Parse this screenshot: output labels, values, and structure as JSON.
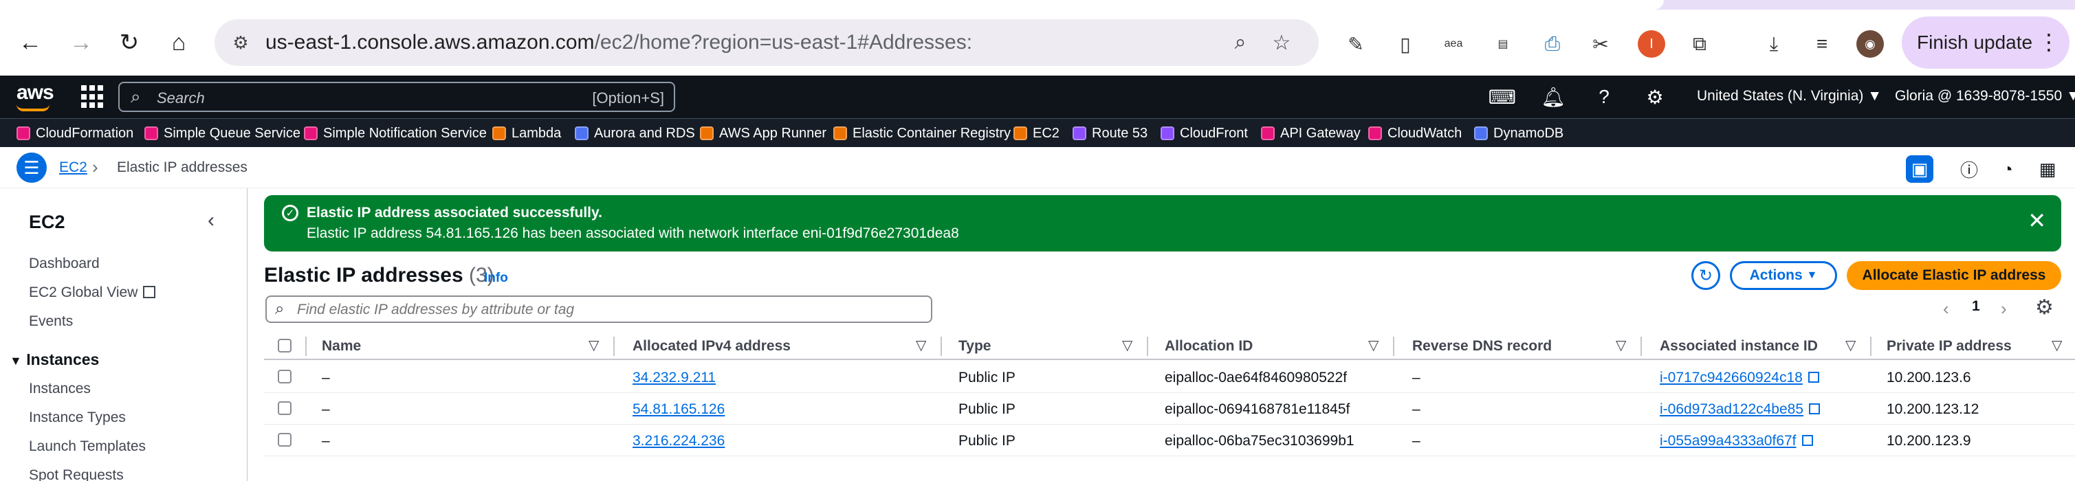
{
  "browser": {
    "url_host": "us-east-1.console.aws.amazon.com",
    "url_path": "/ec2/home?region=us-east-1#Addresses:",
    "finish_update_label": "Finish update"
  },
  "aws_nav": {
    "logo": "aws",
    "search_placeholder": "Search",
    "search_shortcut": "[Option+S]",
    "region": "United States (N. Virginia) ▼",
    "account": "Gloria @ 1639-8078-1550 ▼"
  },
  "favorites": [
    {
      "label": "CloudFormation",
      "color": "#e7157b"
    },
    {
      "label": "Simple Queue Service",
      "color": "#e7157b"
    },
    {
      "label": "Simple Notification Service",
      "color": "#e7157b"
    },
    {
      "label": "Lambda",
      "color": "#ed7100"
    },
    {
      "label": "Aurora and RDS",
      "color": "#4d72f3"
    },
    {
      "label": "AWS App Runner",
      "color": "#ed7100"
    },
    {
      "label": "Elastic Container Registry",
      "color": "#ed7100"
    },
    {
      "label": "EC2",
      "color": "#ed7100"
    },
    {
      "label": "Route 53",
      "color": "#8c4fff"
    },
    {
      "label": "CloudFront",
      "color": "#8c4fff"
    },
    {
      "label": "API Gateway",
      "color": "#e7157b"
    },
    {
      "label": "CloudWatch",
      "color": "#e7157b"
    },
    {
      "label": "DynamoDB",
      "color": "#4d72f3"
    }
  ],
  "breadcrumb": {
    "root": "EC2",
    "current": "Elastic IP addresses"
  },
  "sidenav": {
    "title": "EC2",
    "items": [
      "Dashboard",
      "EC2 Global View",
      "Events"
    ],
    "section": "Instances",
    "section_items": [
      "Instances",
      "Instance Types",
      "Launch Templates",
      "Spot Requests"
    ]
  },
  "flash": {
    "heading": "Elastic IP address associated successfully.",
    "body": "Elastic IP address 54.81.165.126 has been associated with network interface eni-01f9d76e27301dea8",
    "color": "#00802f"
  },
  "main": {
    "title": "Elastic IP addresses",
    "count": "(3)",
    "info": "Info",
    "actions_label": "Actions",
    "allocate_label": "Allocate Elastic IP address",
    "filter_placeholder": "Find elastic IP addresses by attribute or tag",
    "page": "1"
  },
  "table": {
    "columns": [
      "Name",
      "Allocated IPv4 address",
      "Type",
      "Allocation ID",
      "Reverse DNS record",
      "Associated instance ID",
      "Private IP address"
    ],
    "rows": [
      {
        "name": "–",
        "ip": "34.232.9.211",
        "type": "Public IP",
        "alloc": "eipalloc-0ae64f8460980522f",
        "rdns": "–",
        "instance": "i-0717c942660924c18",
        "private": "10.200.123.6"
      },
      {
        "name": "–",
        "ip": "54.81.165.126",
        "type": "Public IP",
        "alloc": "eipalloc-0694168781e11845f",
        "rdns": "–",
        "instance": "i-06d973ad122c4be85",
        "private": "10.200.123.12"
      },
      {
        "name": "–",
        "ip": "3.216.224.236",
        "type": "Public IP",
        "alloc": "eipalloc-06ba75ec3103699b1",
        "rdns": "–",
        "instance": "i-055a99a4333a0f67f",
        "private": "10.200.123.9"
      }
    ]
  },
  "colors": {
    "accent": "#006ce0",
    "primary_button": "#ff9900",
    "nav_bg": "#0f141a",
    "success": "#00802f"
  }
}
